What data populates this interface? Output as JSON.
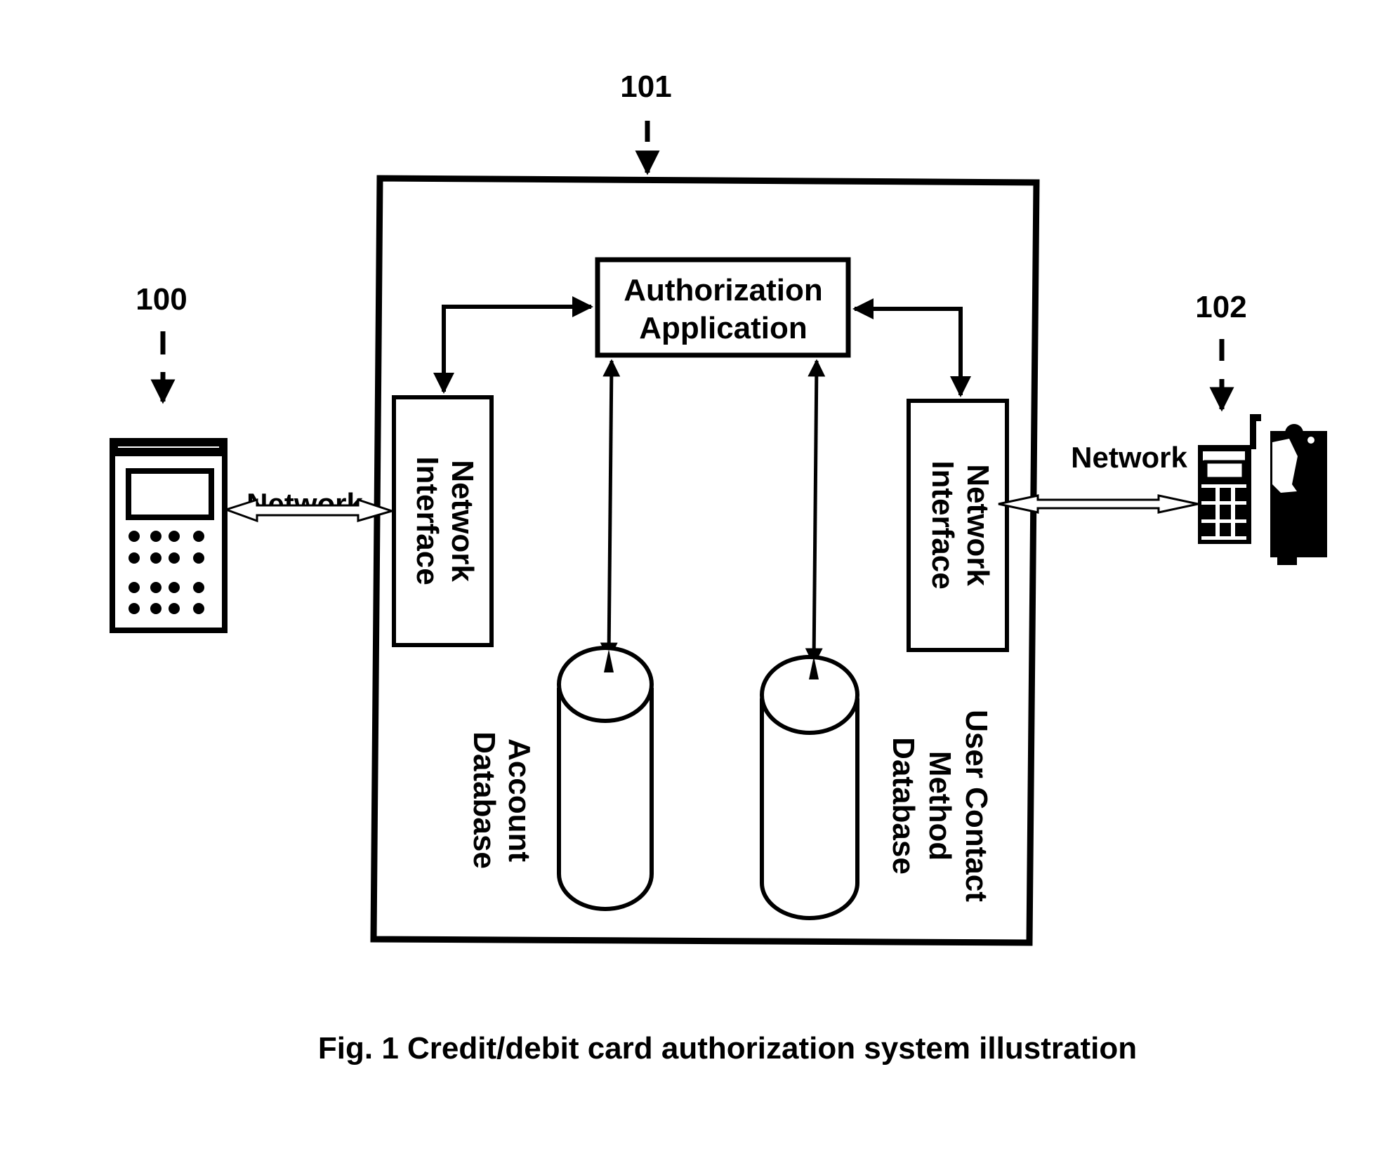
{
  "figure": {
    "caption": "Fig. 1 Credit/debit card authorization system illustration",
    "colors": {
      "ink": "#000000",
      "paper": "#ffffff"
    }
  },
  "references": {
    "terminal": "100",
    "server": "101",
    "user_phone": "102"
  },
  "server": {
    "authorization_application": [
      "Authorization",
      "Application"
    ],
    "network_interface_left": [
      "Network",
      "Interface"
    ],
    "network_interface_right": [
      "Network",
      "Interface"
    ],
    "account_database": [
      "Account",
      "Database"
    ],
    "user_contact_database": [
      "User Contact",
      "Method",
      "Database"
    ]
  },
  "links": {
    "left_network": "Network",
    "right_network": "Network"
  },
  "icons": {
    "terminal": "card-terminal-icon",
    "phone": "mobile-phone-icon",
    "person": "user-person-icon"
  }
}
